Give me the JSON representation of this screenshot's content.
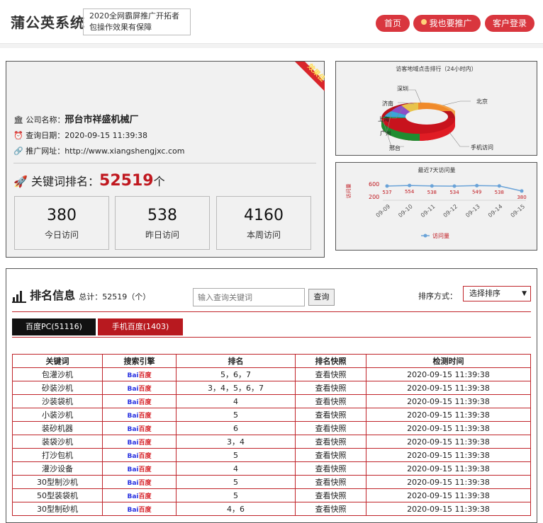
{
  "header": {
    "logo": "蒲公英系统",
    "slogan_line1": "2020全网霸屏推广开拓者",
    "slogan_line2": "包操作效果有保障",
    "nav": [
      "首页",
      "我也要推广",
      "客户登录"
    ]
  },
  "company": {
    "ribbon": "效果佳",
    "name_label": "公司名称：",
    "name": "邢台市祥盛机械厂",
    "date_label": "查询日期：",
    "date": "2020-09-15 11:39:38",
    "url_label": "推广网址：",
    "url": "http://www.xiangshengjxc.com",
    "kw_label": "关键词排名：",
    "kw_count": "52519",
    "kw_unit": "个"
  },
  "stats": [
    {
      "num": "380",
      "label": "今日访问"
    },
    {
      "num": "538",
      "label": "昨日访问"
    },
    {
      "num": "4160",
      "label": "本周访问"
    }
  ],
  "pie": {
    "title": "访客地域点击排行（24小时内）",
    "labels": [
      "深圳",
      "济南",
      "上海",
      "广州",
      "邢台",
      "北京",
      "手机访问"
    ]
  },
  "chart_data": {
    "type": "line",
    "title": "最近7天访问量",
    "ylabel": "访问量",
    "x": [
      "09-09",
      "09-10",
      "09-11",
      "09-12",
      "09-13",
      "09-14",
      "09-15"
    ],
    "series": [
      {
        "name": "访问量",
        "values": [
          537,
          554,
          538,
          534,
          549,
          538,
          380
        ]
      }
    ],
    "yticks": [
      "600",
      "200"
    ],
    "ylim": [
      200,
      600
    ],
    "color": "#6aa3d8"
  },
  "ranking": {
    "title": "排名信息",
    "total_label": "总计：52519（个）",
    "search_placeholder": "输入查询关键词",
    "search_button": "查询",
    "sort_label": "排序方式：",
    "sort_value": "选择排序",
    "tabs": [
      "百度PC(51116)",
      "手机百度(1403)"
    ],
    "columns": [
      "关键词",
      "搜索引擎",
      "排名",
      "排名快照",
      "检测时间"
    ],
    "engine_logo": "Bai百度",
    "rows": [
      [
        "包灌沙机",
        "5，6，7",
        "查看快照",
        "2020-09-15 11:39:38"
      ],
      [
        "砂装沙机",
        "3，4，5，6，7",
        "查看快照",
        "2020-09-15 11:39:38"
      ],
      [
        "沙装袋机",
        "4",
        "查看快照",
        "2020-09-15 11:39:38"
      ],
      [
        "小装沙机",
        "5",
        "查看快照",
        "2020-09-15 11:39:38"
      ],
      [
        "装砂机器",
        "6",
        "查看快照",
        "2020-09-15 11:39:38"
      ],
      [
        "装袋沙机",
        "3，4",
        "查看快照",
        "2020-09-15 11:39:38"
      ],
      [
        "打沙包机",
        "5",
        "查看快照",
        "2020-09-15 11:39:38"
      ],
      [
        "灌沙设备",
        "4",
        "查看快照",
        "2020-09-15 11:39:38"
      ],
      [
        "30型制沙机",
        "5",
        "查看快照",
        "2020-09-15 11:39:38"
      ],
      [
        "50型装袋机",
        "5",
        "查看快照",
        "2020-09-15 11:39:38"
      ],
      [
        "30型制砂机",
        "4，6",
        "查看快照",
        "2020-09-15 11:39:38"
      ]
    ]
  }
}
